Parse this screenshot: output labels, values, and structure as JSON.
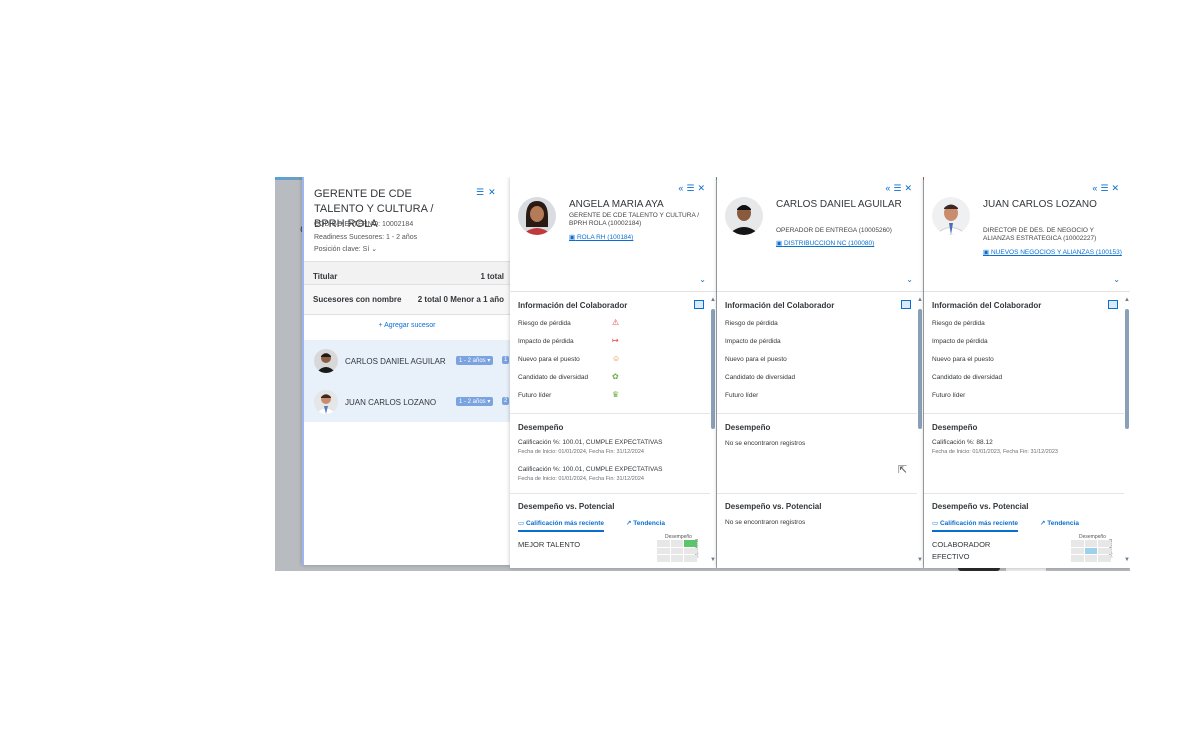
{
  "background": {
    "label": "C"
  },
  "position_card": {
    "title": "GERENTE DE CDE TALENTO Y CULTURA / BPRH ROLA",
    "external_code": "CODIGO EXTERNO: 10002184",
    "readiness": "Readiness Sucesores: 1 - 2 años",
    "key_position": "Posición clave:",
    "key_position_value": "Sí",
    "icons": [
      "list-icon",
      "close-icon"
    ],
    "incumbent_label": "Titular",
    "incumbent_count": "1 total",
    "successors_label": "Sucesores con nombre",
    "successors_count": "2 total 0 Menor a 1 año",
    "add_successor": "+ Agregar sucesor",
    "successors": [
      {
        "name": "CARLOS DANIEL AGUILAR",
        "readiness": "1 - 2 años",
        "rank": "1"
      },
      {
        "name": "JUAN CARLOS LOZANO",
        "readiness": "1 - 2 años",
        "rank": "2"
      }
    ]
  },
  "info_section": {
    "title": "Información del Colaborador",
    "items": [
      "Riesgo de pérdida",
      "Impacto de pérdida",
      "Nuevo para el puesto",
      "Candidato de diversidad",
      "Futuro líder"
    ]
  },
  "performance_title": "Desempeño",
  "perf_potential_title": "Desempeño vs. Potencial",
  "tab_recent": "Calificación más reciente",
  "tab_trend": "Tendencia",
  "no_records": "No se encontraron registros",
  "mini_grid_label": "Desempeño",
  "mini_grid_vlabel": "Potencial",
  "people": [
    {
      "name": "ANGELA MARIA AYA",
      "role": "GERENTE DE CDE TALENTO Y CULTURA / BPRH ROLA (10002184)",
      "org": "ROLA RH (100184)",
      "performance": [
        {
          "rating": "Calificación %: 100.01, CUMPLE EXPECTATIVAS",
          "dates": "Fecha de Inicio: 01/01/2024, Fecha Fin: 31/12/2024"
        },
        {
          "rating": "Calificación %: 100.01, CUMPLE EXPECTATIVAS",
          "dates": "Fecha de Inicio: 01/01/2024, Fecha Fin: 31/12/2024"
        }
      ],
      "potential_result": "MEJOR TALENTO"
    },
    {
      "name": "CARLOS DANIEL AGUILAR",
      "role": "OPERADOR DE ENTREGA (10005260)",
      "org": "DISTRIBUCCION NC (100080)",
      "performance": [],
      "potential_result": ""
    },
    {
      "name": "JUAN CARLOS LOZANO",
      "role": "DIRECTOR DE DES. DE NEGOCIO Y ALIANZAS ESTRATEGICA (10002227)",
      "org": "NUEVOS NEGOCIOS Y ALIANZAS (100153)",
      "performance": [
        {
          "rating": "Calificación %: 88.12",
          "dates": "Fecha de Inicio: 01/01/2023, Fecha Fin: 31/12/2023"
        }
      ],
      "potential_result": "COLABORADOR EFECTIVO"
    }
  ],
  "colors": {
    "accent": "#0a6ed1",
    "selection": "#e8f0fa",
    "tag": "#7aa3e0",
    "grid_green": "#5cc46a",
    "grid_blue": "#9fd0ea"
  }
}
